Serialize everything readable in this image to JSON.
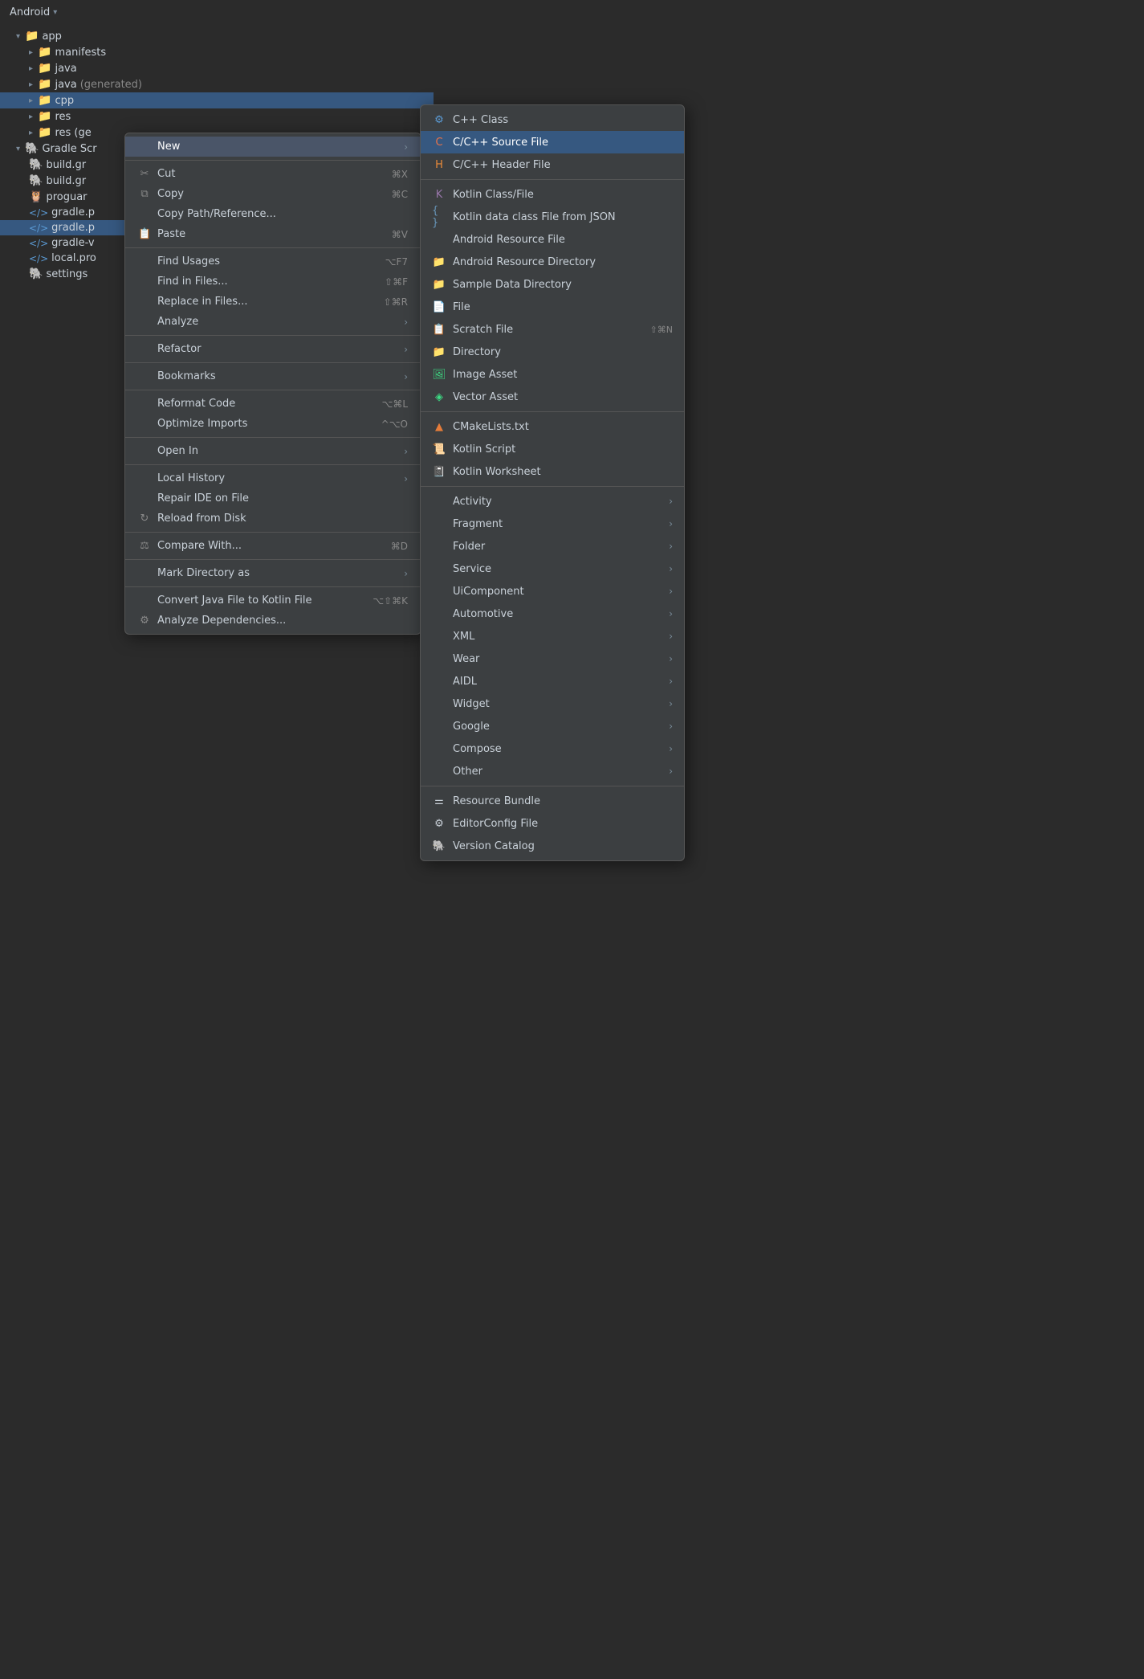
{
  "titleBar": {
    "label": "Android",
    "dropdownChar": "▾"
  },
  "fileTree": [
    {
      "id": "app",
      "label": "app",
      "indent": 1,
      "icon": "📁",
      "arrow": "▾",
      "iconClass": "app-icon",
      "selected": false
    },
    {
      "id": "manifests",
      "label": "manifests",
      "indent": 2,
      "icon": "📁",
      "arrow": "▸",
      "iconClass": "manifests-icon",
      "selected": false
    },
    {
      "id": "java",
      "label": "java",
      "indent": 2,
      "icon": "📁",
      "arrow": "▸",
      "iconClass": "java-icon",
      "selected": false
    },
    {
      "id": "java-gen",
      "label": "java",
      "suffix": "(generated)",
      "indent": 2,
      "icon": "📁",
      "arrow": "▸",
      "iconClass": "java-gen-icon",
      "selected": false
    },
    {
      "id": "cpp",
      "label": "cpp",
      "indent": 2,
      "icon": "📁",
      "arrow": "▸",
      "iconClass": "cpp-icon",
      "selected": true
    },
    {
      "id": "res",
      "label": "res",
      "indent": 2,
      "icon": "📁",
      "arrow": "▸",
      "iconClass": "res-icon",
      "selected": false
    },
    {
      "id": "res-gen",
      "label": "res (ge",
      "indent": 2,
      "icon": "📁",
      "arrow": "▸",
      "iconClass": "res-gen-icon",
      "selected": false
    },
    {
      "id": "gradle-scripts",
      "label": "Gradle Scr",
      "indent": 1,
      "icon": "🐘",
      "arrow": "▾",
      "iconClass": "gradle-icon",
      "selected": false
    },
    {
      "id": "build-gr1",
      "label": "build.gr",
      "indent": 2,
      "icon": "🐘",
      "iconClass": "gradle-icon",
      "selected": false
    },
    {
      "id": "build-gr2",
      "label": "build.gr",
      "indent": 2,
      "icon": "🐘",
      "iconClass": "gradle-icon",
      "selected": false
    },
    {
      "id": "proguard",
      "label": "proguar",
      "indent": 2,
      "icon": "🦉",
      "iconClass": "proguard-icon",
      "selected": false
    },
    {
      "id": "gradle-p1",
      "label": "gradle.p",
      "indent": 2,
      "icon": "📄",
      "iconClass": "gradle-file-icon",
      "selected": false
    },
    {
      "id": "gradle-p2",
      "label": "gradle.p",
      "indent": 2,
      "icon": "📄",
      "iconClass": "gradle-file-icon",
      "selected": true
    },
    {
      "id": "gradle-v",
      "label": "gradle-v",
      "indent": 2,
      "icon": "📄",
      "iconClass": "gradle-file-icon",
      "selected": false
    },
    {
      "id": "local-pro",
      "label": "local.pro",
      "indent": 2,
      "icon": "📄",
      "iconClass": "gradle-file-icon",
      "selected": false
    },
    {
      "id": "settings",
      "label": "settings",
      "indent": 2,
      "icon": "🐘",
      "iconClass": "gradle-icon",
      "selected": false
    }
  ],
  "contextMenu": {
    "items": [
      {
        "id": "new",
        "label": "New",
        "hasArrow": true,
        "icon": "",
        "shortcut": "",
        "type": "new"
      },
      {
        "id": "sep1",
        "type": "separator"
      },
      {
        "id": "cut",
        "label": "Cut",
        "icon": "✂",
        "shortcut": "⌘X"
      },
      {
        "id": "copy",
        "label": "Copy",
        "icon": "⧉",
        "shortcut": "⌘C"
      },
      {
        "id": "copy-path",
        "label": "Copy Path/Reference...",
        "icon": "",
        "shortcut": ""
      },
      {
        "id": "paste",
        "label": "Paste",
        "icon": "📋",
        "shortcut": "⌘V"
      },
      {
        "id": "sep2",
        "type": "separator"
      },
      {
        "id": "find-usages",
        "label": "Find Usages",
        "icon": "",
        "shortcut": "⌥F7"
      },
      {
        "id": "find-in-files",
        "label": "Find in Files...",
        "icon": "",
        "shortcut": "⇧⌘F"
      },
      {
        "id": "replace-in-files",
        "label": "Replace in Files...",
        "icon": "",
        "shortcut": "⇧⌘R"
      },
      {
        "id": "analyze",
        "label": "Analyze",
        "icon": "",
        "shortcut": "",
        "hasArrow": true
      },
      {
        "id": "sep3",
        "type": "separator"
      },
      {
        "id": "refactor",
        "label": "Refactor",
        "icon": "",
        "shortcut": "",
        "hasArrow": true
      },
      {
        "id": "sep4",
        "type": "separator"
      },
      {
        "id": "bookmarks",
        "label": "Bookmarks",
        "icon": "",
        "shortcut": "",
        "hasArrow": true
      },
      {
        "id": "sep5",
        "type": "separator"
      },
      {
        "id": "reformat",
        "label": "Reformat Code",
        "icon": "",
        "shortcut": "⌥⌘L"
      },
      {
        "id": "optimize",
        "label": "Optimize Imports",
        "icon": "",
        "shortcut": "^⌥O"
      },
      {
        "id": "sep6",
        "type": "separator"
      },
      {
        "id": "open-in",
        "label": "Open In",
        "icon": "",
        "shortcut": "",
        "hasArrow": true
      },
      {
        "id": "sep7",
        "type": "separator"
      },
      {
        "id": "local-history",
        "label": "Local History",
        "icon": "",
        "shortcut": "",
        "hasArrow": true
      },
      {
        "id": "repair-ide",
        "label": "Repair IDE on File",
        "icon": "",
        "shortcut": ""
      },
      {
        "id": "reload",
        "label": "Reload from Disk",
        "icon": "↻",
        "shortcut": ""
      },
      {
        "id": "sep8",
        "type": "separator"
      },
      {
        "id": "compare-with",
        "label": "Compare With...",
        "icon": "⚖",
        "shortcut": "⌘D"
      },
      {
        "id": "sep9",
        "type": "separator"
      },
      {
        "id": "mark-dir",
        "label": "Mark Directory as",
        "icon": "",
        "shortcut": "",
        "hasArrow": true
      },
      {
        "id": "sep10",
        "type": "separator"
      },
      {
        "id": "convert-java",
        "label": "Convert Java File to Kotlin File",
        "icon": "",
        "shortcut": "⌥⇧⌘K"
      },
      {
        "id": "analyze-deps",
        "label": "Analyze Dependencies...",
        "icon": "⚙",
        "shortcut": ""
      }
    ]
  },
  "subMenu": {
    "items": [
      {
        "id": "cpp-class",
        "label": "C++ Class",
        "iconChar": "⚙",
        "iconClass": "icon-cpp",
        "hasArrow": false
      },
      {
        "id": "cpp-source",
        "label": "C/C++ Source File",
        "iconChar": "C",
        "iconClass": "icon-cpp-c",
        "hasArrow": false,
        "active": true
      },
      {
        "id": "cpp-header",
        "label": "C/C++ Header File",
        "iconChar": "H",
        "iconClass": "icon-header",
        "hasArrow": false
      },
      {
        "id": "sep1",
        "type": "separator"
      },
      {
        "id": "kotlin-class",
        "label": "Kotlin Class/File",
        "iconChar": "K",
        "iconClass": "icon-kotlin",
        "hasArrow": false
      },
      {
        "id": "kotlin-data",
        "label": "Kotlin data class File from JSON",
        "iconChar": "{ }",
        "iconClass": "icon-kotlin-data",
        "hasArrow": false
      },
      {
        "id": "android-res-file",
        "label": "Android Resource File",
        "iconChar": "</>",
        "iconClass": "icon-android",
        "hasArrow": false
      },
      {
        "id": "android-res-dir",
        "label": "Android Resource Directory",
        "iconChar": "📁",
        "iconClass": "icon-folder",
        "hasArrow": false
      },
      {
        "id": "sample-data",
        "label": "Sample Data Directory",
        "iconChar": "📁",
        "iconClass": "icon-folder",
        "hasArrow": false
      },
      {
        "id": "file",
        "label": "File",
        "iconChar": "📄",
        "iconClass": "icon-file",
        "hasArrow": false
      },
      {
        "id": "scratch",
        "label": "Scratch File",
        "iconChar": "📋",
        "iconClass": "icon-scratch",
        "shortcut": "⇧⌘N",
        "hasArrow": false
      },
      {
        "id": "directory",
        "label": "Directory",
        "iconChar": "📁",
        "iconClass": "icon-folder",
        "hasArrow": false
      },
      {
        "id": "image-asset",
        "label": "Image Asset",
        "iconChar": "🖼",
        "iconClass": "icon-image",
        "hasArrow": false
      },
      {
        "id": "vector-asset",
        "label": "Vector Asset",
        "iconChar": "◈",
        "iconClass": "icon-vector",
        "hasArrow": false
      },
      {
        "id": "sep2",
        "type": "separator"
      },
      {
        "id": "cmake",
        "label": "CMakeLists.txt",
        "iconChar": "▲",
        "iconClass": "icon-cmake",
        "hasArrow": false
      },
      {
        "id": "kotlin-script",
        "label": "Kotlin Script",
        "iconChar": "📜",
        "iconClass": "icon-kotlin-script",
        "hasArrow": false
      },
      {
        "id": "kotlin-worksheet",
        "label": "Kotlin Worksheet",
        "iconChar": "📓",
        "iconClass": "icon-kotlin-script",
        "hasArrow": false
      },
      {
        "id": "sep3",
        "type": "separator"
      },
      {
        "id": "activity",
        "label": "Activity",
        "hasArrow": true
      },
      {
        "id": "fragment",
        "label": "Fragment",
        "hasArrow": true
      },
      {
        "id": "folder",
        "label": "Folder",
        "hasArrow": true
      },
      {
        "id": "service",
        "label": "Service",
        "hasArrow": true
      },
      {
        "id": "ui-component",
        "label": "UiComponent",
        "hasArrow": true
      },
      {
        "id": "automotive",
        "label": "Automotive",
        "hasArrow": true
      },
      {
        "id": "xml",
        "label": "XML",
        "hasArrow": true
      },
      {
        "id": "wear",
        "label": "Wear",
        "hasArrow": true
      },
      {
        "id": "aidl",
        "label": "AIDL",
        "hasArrow": true
      },
      {
        "id": "widget",
        "label": "Widget",
        "hasArrow": true
      },
      {
        "id": "google",
        "label": "Google",
        "hasArrow": true
      },
      {
        "id": "compose",
        "label": "Compose",
        "hasArrow": true
      },
      {
        "id": "other",
        "label": "Other",
        "hasArrow": true
      },
      {
        "id": "sep4",
        "type": "separator"
      },
      {
        "id": "resource-bundle",
        "label": "Resource Bundle",
        "iconChar": "⚌",
        "hasArrow": false
      },
      {
        "id": "editorconfig",
        "label": "EditorConfig File",
        "iconChar": "⚙",
        "hasArrow": false
      },
      {
        "id": "version-catalog",
        "label": "Version Catalog",
        "iconChar": "🐘",
        "hasArrow": false
      }
    ]
  }
}
